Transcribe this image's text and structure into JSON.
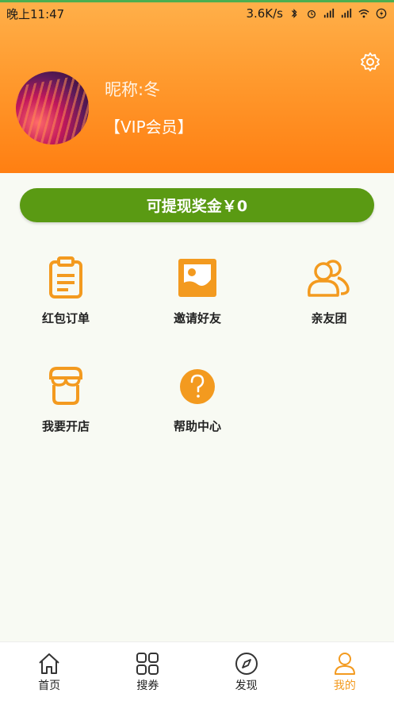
{
  "status_bar": {
    "time": "晚上11:47",
    "speed": "3.6K/s"
  },
  "profile": {
    "nickname": "昵称:冬",
    "membership": "【VIP会员】"
  },
  "bonus": {
    "label": "可提现奖金￥0"
  },
  "menu": {
    "items": [
      {
        "label": "红包订单",
        "icon": "clipboard-icon"
      },
      {
        "label": "邀请好友",
        "icon": "image-icon"
      },
      {
        "label": "亲友团",
        "icon": "group-icon"
      },
      {
        "label": "我要开店",
        "icon": "store-icon"
      },
      {
        "label": "帮助中心",
        "icon": "help-icon"
      }
    ]
  },
  "tabbar": {
    "items": [
      {
        "label": "首页",
        "icon": "home-icon"
      },
      {
        "label": "搜券",
        "icon": "grid-icon"
      },
      {
        "label": "发现",
        "icon": "compass-icon"
      },
      {
        "label": "我的",
        "icon": "user-icon"
      }
    ],
    "active_index": 3
  },
  "colors": {
    "accent_orange": "#f39a1f",
    "bonus_green": "#5a9a13",
    "header_gradient_top": "#ffb04a",
    "header_gradient_bottom": "#ff7f12"
  }
}
